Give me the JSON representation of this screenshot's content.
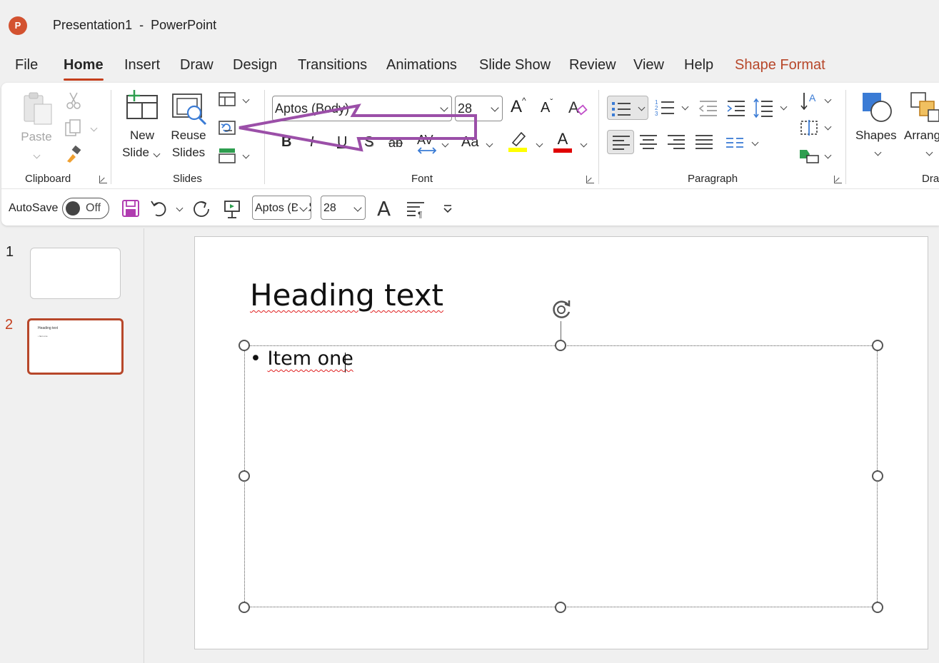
{
  "window": {
    "title": "Presentation1  -  PowerPoint",
    "app_logo": "P"
  },
  "menu": {
    "file": "File",
    "home": "Home",
    "insert": "Insert",
    "draw": "Draw",
    "design": "Design",
    "transitions": "Transitions",
    "animations": "Animations",
    "slide_show": "Slide Show",
    "review": "Review",
    "view": "View",
    "help": "Help",
    "shape_format": "Shape Format"
  },
  "ribbon": {
    "clipboard": {
      "paste": "Paste",
      "label": "Clipboard"
    },
    "slides": {
      "new_slide_1": "New",
      "new_slide_2": "Slide",
      "reuse_1": "Reuse",
      "reuse_2": "Slides",
      "label": "Slides"
    },
    "font": {
      "font_name": "Aptos (Body)",
      "font_size": "28",
      "grow": "A",
      "shrink": "A",
      "bold": "B",
      "italic": "I",
      "underline": "U",
      "strike": "S",
      "strikethrough_ab": "ab",
      "spacing": "AV",
      "change_case": "Aa",
      "font_color": "A",
      "label": "Font"
    },
    "paragraph": {
      "label": "Paragraph"
    },
    "drawing": {
      "shapes": "Shapes",
      "arrange": "Arrange",
      "label": "Dra"
    }
  },
  "qat": {
    "autosave_label": "AutoSave",
    "autosave_state": "Off",
    "font_name": "Aptos (Body)",
    "font_size": "28",
    "font_size_icon": "A"
  },
  "slides_panel": {
    "thumbs": [
      {
        "number": "1"
      },
      {
        "number": "2",
        "mini_title": "Heading text",
        "mini_body": "• Item one"
      }
    ]
  },
  "slide": {
    "title": "Heading text",
    "bullet": "•",
    "body_text": "Item one"
  },
  "colors": {
    "accent": "#c43e1c",
    "contextual": "#b7472a",
    "annotation_arrow": "#9b4fa8",
    "highlight": "#ffff00",
    "font_red": "#e00000"
  }
}
